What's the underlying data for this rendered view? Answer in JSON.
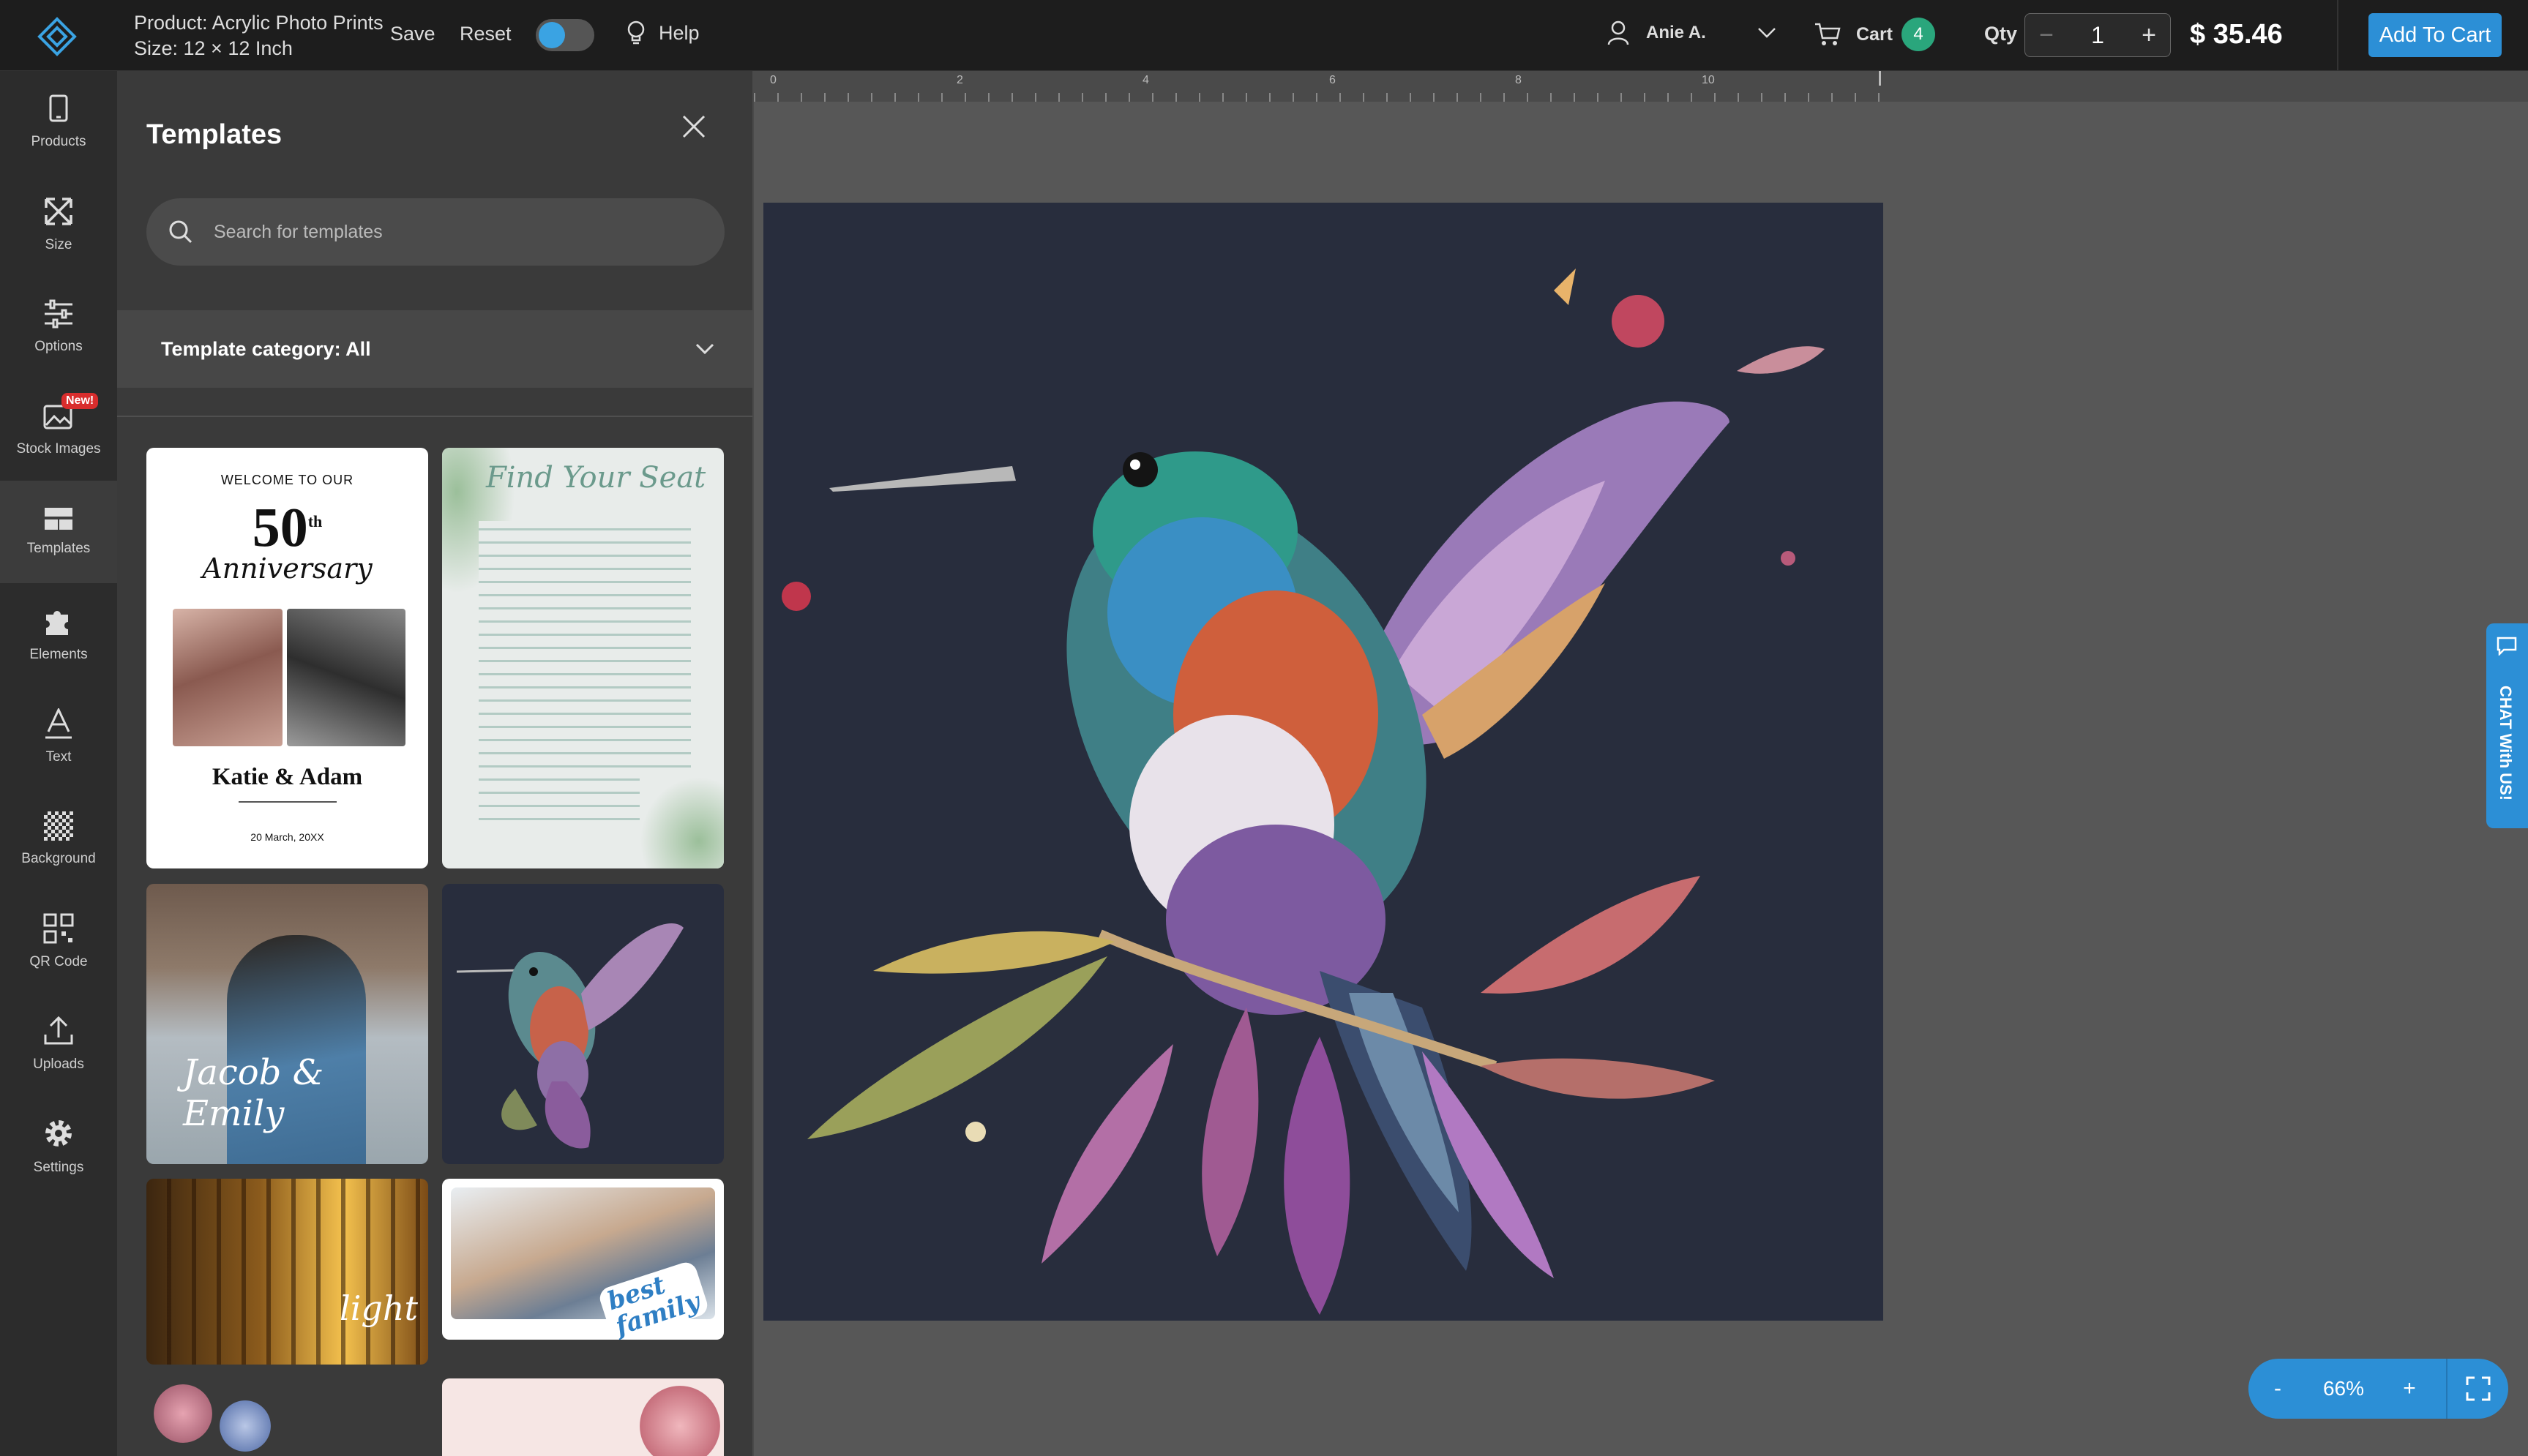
{
  "header": {
    "product_line1": "Product: Acrylic Photo Prints",
    "product_line2": "Size: 12 × 12 Inch",
    "save": "Save",
    "reset": "Reset",
    "help": "Help",
    "user": "Anie A.",
    "cart": "Cart",
    "cart_count": "4",
    "qty_label": "Qty",
    "qty_value": "1",
    "price": "$ 35.46",
    "add_to_cart": "Add To Cart",
    "accent": "#2c8fd6"
  },
  "sidebar": {
    "items": [
      {
        "label": "Products",
        "icon": "phone-icon"
      },
      {
        "label": "Size",
        "icon": "resize-icon"
      },
      {
        "label": "Options",
        "icon": "sliders-icon"
      },
      {
        "label": "Stock Images",
        "icon": "images-icon",
        "badge": "New!"
      },
      {
        "label": "Templates",
        "icon": "templates-icon"
      },
      {
        "label": "Elements",
        "icon": "puzzle-icon"
      },
      {
        "label": "Text",
        "icon": "text-icon"
      },
      {
        "label": "Background",
        "icon": "checker-icon"
      },
      {
        "label": "QR Code",
        "icon": "qr-icon"
      },
      {
        "label": "Uploads",
        "icon": "upload-icon"
      },
      {
        "label": "Settings",
        "icon": "gear-icon"
      }
    ]
  },
  "templates": {
    "title": "Templates",
    "search_placeholder": "Search for templates",
    "category": "Template category: All",
    "t1": {
      "line1": "WELCOME TO OUR",
      "num": "50",
      "sup": "th",
      "script": "Anniversary",
      "names": "Katie & Adam",
      "date": "20 March, 20XX"
    },
    "t2": {
      "title": "Find Your Seat"
    },
    "t3": {
      "script": "Jacob & Emily"
    },
    "t5": {
      "script": "light"
    },
    "t6": {
      "line1": "best",
      "line2": "family"
    }
  },
  "ruler": {
    "ticks": [
      "0",
      "2",
      "4",
      "6",
      "8",
      "10"
    ]
  },
  "chat": {
    "label": "CHAT With US!"
  },
  "zoom": {
    "minus": "-",
    "value": "66%",
    "plus": "+"
  }
}
